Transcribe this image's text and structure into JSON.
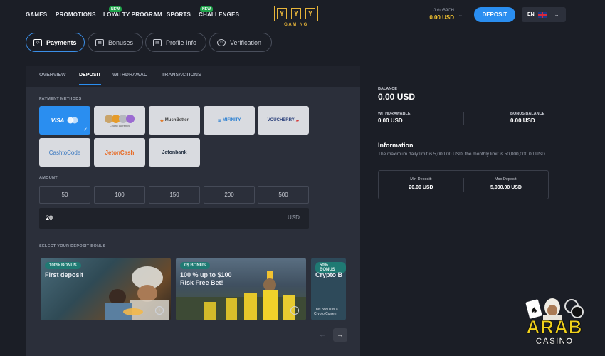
{
  "nav": {
    "items": [
      "GAMES",
      "PROMOTIONS",
      "LOYALTY PROGRAM",
      "SPORTS",
      "CHALLENGES"
    ],
    "new_badge": "NEW",
    "logo_text": "GAMING",
    "logo_glyph": "Y"
  },
  "user": {
    "name": "JohnB9CH",
    "balance": "0.00 USD"
  },
  "header": {
    "deposit_label": "DEPOSIT",
    "lang": "EN"
  },
  "account_tabs": [
    "Payments",
    "Bonuses",
    "Profile Info",
    "Verification"
  ],
  "subtabs": [
    "OVERVIEW",
    "DEPOSIT",
    "WITHDRAWAL",
    "TRANSACTIONS"
  ],
  "payment": {
    "label": "PAYMENT METHODS",
    "methods": [
      "VISA",
      "Crypto currency",
      "MuchBetter",
      "MIFINITY",
      "VOUCHERRY",
      "CashtoCode",
      "JetonCash",
      "Jetonbank"
    ]
  },
  "amount": {
    "label": "AMOUNT",
    "presets": [
      "50",
      "100",
      "150",
      "200",
      "500"
    ],
    "value": "20",
    "currency": "USD"
  },
  "bonus": {
    "label": "SELECT YOUR DEPOSIT BONUS",
    "cards": [
      {
        "badge": "100% BONUS",
        "title": "First deposit"
      },
      {
        "badge": "0$ BONUS",
        "title": "100 % up to $100\nRisk Free Bet!"
      },
      {
        "badge": "50% BONUS",
        "title": "Crypto B"
      }
    ],
    "partial_text": "This bonus is a\nCrypto Curren"
  },
  "summary": {
    "balance_label": "BALANCE",
    "balance_value": "0.00 USD",
    "withdrawable_label": "WITHDRAWABLE",
    "withdrawable_value": "0.00 USD",
    "bonus_balance_label": "BONUS BALANCE",
    "bonus_balance_value": "0.00 USD",
    "info_title": "Information",
    "info_text": "The maximum daily limit is 5,000.00 USD, the monthly limit is 50,000,000.00 USD",
    "min_label": "Min Deposit:",
    "min_value": "20.00 USD",
    "max_label": "Max Deposit:",
    "max_value": "5,000.00 USD"
  },
  "watermark": {
    "line1": "ARAB",
    "line2": "CASINO"
  }
}
